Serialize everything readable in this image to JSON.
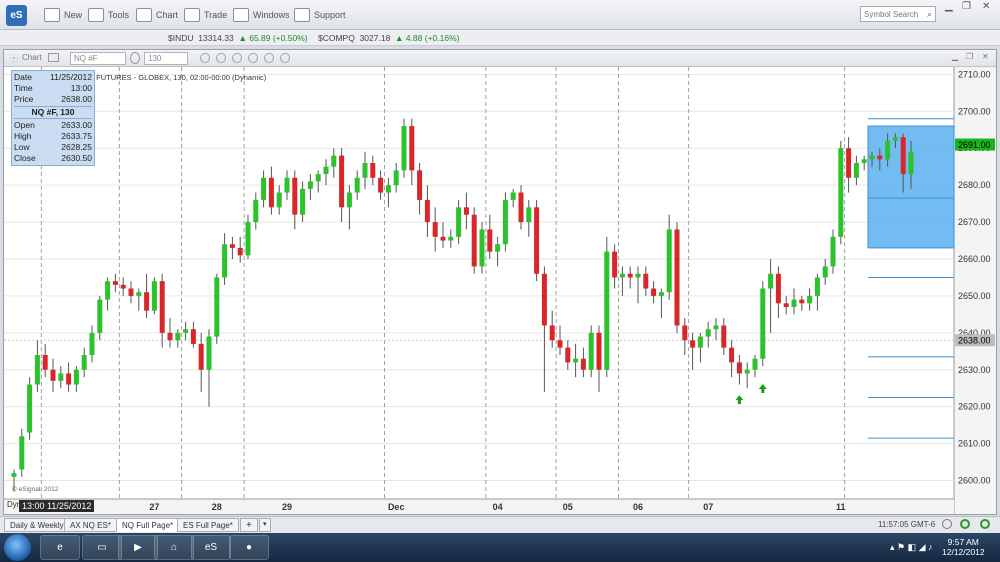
{
  "app": {
    "icon_label": "eS",
    "menu": [
      {
        "label": "New",
        "icon": "new-icon"
      },
      {
        "label": "Tools",
        "icon": "tools-icon"
      },
      {
        "label": "Chart",
        "icon": "chart-icon"
      },
      {
        "label": "Trade",
        "icon": "trade-icon"
      },
      {
        "label": "Windows",
        "icon": "windows-icon"
      },
      {
        "label": "Support",
        "icon": "support-icon"
      }
    ],
    "symbol_search_placeholder": "Symbol Search"
  },
  "ticker": [
    {
      "symbol": "$INDU",
      "price": "13314.33",
      "change": "65.89 (+0.50%)"
    },
    {
      "symbol": "$COMPQ",
      "price": "3027.18",
      "change": "4.88 (+0.16%)"
    }
  ],
  "chart_window": {
    "tab_label": "Chart",
    "symbol_input": "NQ #F",
    "interval_input": "130",
    "title": "I FUTURES - GLOBEX, 130, 02:00-00:00 (Dynamic)",
    "watermark": "© eSignal, 2012",
    "dyn_label": "Dyn",
    "highlight_date": "13:00 11/25/2012"
  },
  "data_window": {
    "date_label": "Date",
    "date_value": "11/25/2012",
    "time_label": "Time",
    "time_value": "13:00",
    "price_label": "Price",
    "price_value": "2638.00",
    "symbol_header": "NQ #F, 130",
    "open_label": "Open",
    "open_value": "2633.00",
    "high_label": "High",
    "high_value": "2633.75",
    "low_label": "Low",
    "low_value": "2628.25",
    "close_label": "Close",
    "close_value": "2630.50"
  },
  "chart_data": {
    "type": "candlestick",
    "y_range": [
      2595,
      2712
    ],
    "y_ticks": [
      2600,
      2610,
      2620,
      2630,
      2640,
      2650,
      2660,
      2670,
      2680,
      2690,
      2700,
      2710
    ],
    "x_labels": [
      "27",
      "28",
      "29",
      "Dec",
      "04",
      "05",
      "06",
      "07",
      "11"
    ],
    "price_labels": [
      {
        "value": "2691.00",
        "price": 2691,
        "color": "#17b517"
      },
      {
        "value": "2638.00",
        "price": 2638,
        "color": "#bdbdbd"
      }
    ],
    "up_color": "#2bc22b",
    "down_color": "#d9262b",
    "candles": [
      [
        2601,
        2603,
        2597,
        2602
      ],
      [
        2603,
        2614,
        2601,
        2612
      ],
      [
        2613,
        2628,
        2611,
        2626
      ],
      [
        2626,
        2638,
        2624,
        2634
      ],
      [
        2634,
        2637,
        2628,
        2630
      ],
      [
        2630,
        2633,
        2624,
        2627
      ],
      [
        2627,
        2631,
        2625,
        2629
      ],
      [
        2629,
        2632,
        2624,
        2626
      ],
      [
        2626,
        2631,
        2624,
        2630
      ],
      [
        2630,
        2636,
        2628,
        2634
      ],
      [
        2634,
        2642,
        2632,
        2640
      ],
      [
        2640,
        2650,
        2638,
        2649
      ],
      [
        2649,
        2655,
        2646,
        2654
      ],
      [
        2654,
        2656,
        2651,
        2653
      ],
      [
        2653,
        2655,
        2650,
        2652
      ],
      [
        2652,
        2654,
        2648,
        2650
      ],
      [
        2650,
        2652,
        2646,
        2651
      ],
      [
        2651,
        2656,
        2644,
        2646
      ],
      [
        2646,
        2655,
        2645,
        2654
      ],
      [
        2654,
        2656,
        2636,
        2640
      ],
      [
        2640,
        2644,
        2636,
        2638
      ],
      [
        2638,
        2641,
        2636,
        2640
      ],
      [
        2640,
        2643,
        2638,
        2641
      ],
      [
        2641,
        2643,
        2636,
        2637
      ],
      [
        2637,
        2640,
        2624,
        2630
      ],
      [
        2630,
        2641,
        2620,
        2639
      ],
      [
        2639,
        2656,
        2637,
        2655
      ],
      [
        2655,
        2667,
        2653,
        2664
      ],
      [
        2664,
        2666,
        2660,
        2663
      ],
      [
        2663,
        2666,
        2659,
        2661
      ],
      [
        2661,
        2672,
        2660,
        2670
      ],
      [
        2670,
        2678,
        2668,
        2676
      ],
      [
        2676,
        2684,
        2674,
        2682
      ],
      [
        2682,
        2685,
        2672,
        2674
      ],
      [
        2674,
        2680,
        2672,
        2678
      ],
      [
        2678,
        2684,
        2676,
        2682
      ],
      [
        2682,
        2684,
        2668,
        2672
      ],
      [
        2672,
        2681,
        2670,
        2679
      ],
      [
        2679,
        2683,
        2676,
        2681
      ],
      [
        2681,
        2684,
        2678,
        2683
      ],
      [
        2683,
        2687,
        2680,
        2685
      ],
      [
        2685,
        2690,
        2682,
        2688
      ],
      [
        2688,
        2690,
        2670,
        2674
      ],
      [
        2674,
        2680,
        2668,
        2678
      ],
      [
        2678,
        2684,
        2676,
        2682
      ],
      [
        2682,
        2689,
        2679,
        2686
      ],
      [
        2686,
        2688,
        2680,
        2682
      ],
      [
        2682,
        2684,
        2676,
        2678
      ],
      [
        2678,
        2682,
        2674,
        2680
      ],
      [
        2680,
        2686,
        2678,
        2684
      ],
      [
        2684,
        2698,
        2682,
        2696
      ],
      [
        2696,
        2698,
        2680,
        2684
      ],
      [
        2684,
        2686,
        2672,
        2676
      ],
      [
        2676,
        2680,
        2666,
        2670
      ],
      [
        2670,
        2674,
        2662,
        2666
      ],
      [
        2666,
        2670,
        2663,
        2665
      ],
      [
        2665,
        2668,
        2663,
        2666
      ],
      [
        2666,
        2676,
        2664,
        2674
      ],
      [
        2674,
        2678,
        2668,
        2672
      ],
      [
        2672,
        2674,
        2656,
        2658
      ],
      [
        2658,
        2670,
        2656,
        2668
      ],
      [
        2668,
        2672,
        2660,
        2662
      ],
      [
        2662,
        2666,
        2658,
        2664
      ],
      [
        2664,
        2678,
        2662,
        2676
      ],
      [
        2676,
        2679,
        2674,
        2678
      ],
      [
        2678,
        2680,
        2668,
        2670
      ],
      [
        2670,
        2676,
        2666,
        2674
      ],
      [
        2674,
        2676,
        2654,
        2656
      ],
      [
        2656,
        2658,
        2624,
        2642
      ],
      [
        2642,
        2646,
        2636,
        2638
      ],
      [
        2638,
        2642,
        2634,
        2636
      ],
      [
        2636,
        2638,
        2630,
        2632
      ],
      [
        2632,
        2637,
        2628,
        2633
      ],
      [
        2633,
        2636,
        2628,
        2630
      ],
      [
        2630,
        2642,
        2628,
        2640
      ],
      [
        2640,
        2642,
        2624,
        2630
      ],
      [
        2630,
        2666,
        2628,
        2662
      ],
      [
        2662,
        2664,
        2652,
        2655
      ],
      [
        2655,
        2658,
        2650,
        2656
      ],
      [
        2656,
        2658,
        2652,
        2655
      ],
      [
        2655,
        2658,
        2648,
        2656
      ],
      [
        2656,
        2658,
        2650,
        2652
      ],
      [
        2652,
        2654,
        2648,
        2650
      ],
      [
        2650,
        2652,
        2644,
        2651
      ],
      [
        2651,
        2672,
        2649,
        2668
      ],
      [
        2668,
        2670,
        2640,
        2642
      ],
      [
        2642,
        2644,
        2634,
        2638
      ],
      [
        2638,
        2640,
        2630,
        2636
      ],
      [
        2636,
        2640,
        2632,
        2639
      ],
      [
        2639,
        2643,
        2636,
        2641
      ],
      [
        2641,
        2644,
        2638,
        2642
      ],
      [
        2642,
        2644,
        2634,
        2636
      ],
      [
        2636,
        2638,
        2628,
        2632
      ],
      [
        2632,
        2634,
        2626,
        2629
      ],
      [
        2629,
        2632,
        2625,
        2630
      ],
      [
        2630,
        2634,
        2628,
        2633
      ],
      [
        2633,
        2654,
        2631,
        2652
      ],
      [
        2652,
        2660,
        2640,
        2656
      ],
      [
        2656,
        2658,
        2644,
        2648
      ],
      [
        2648,
        2650,
        2645,
        2647
      ],
      [
        2647,
        2652,
        2645,
        2649
      ],
      [
        2649,
        2650,
        2646,
        2648
      ],
      [
        2648,
        2652,
        2646,
        2650
      ],
      [
        2650,
        2656,
        2646,
        2655
      ],
      [
        2655,
        2660,
        2653,
        2658
      ],
      [
        2658,
        2668,
        2656,
        2666
      ],
      [
        2666,
        2692,
        2664,
        2690
      ],
      [
        2690,
        2693,
        2678,
        2682
      ],
      [
        2682,
        2688,
        2680,
        2686
      ],
      [
        2686,
        2688,
        2684,
        2687
      ],
      [
        2687,
        2689,
        2685,
        2688
      ],
      [
        2688,
        2690,
        2684,
        2687
      ],
      [
        2687,
        2694,
        2685,
        2692
      ],
      [
        2692,
        2694,
        2690,
        2693
      ],
      [
        2693,
        2694,
        2678,
        2683
      ],
      [
        2683,
        2692,
        2679,
        2689
      ]
    ],
    "rectangle": {
      "price_top": 2696,
      "price_bottom": 2663,
      "from_bar": 110,
      "to_bar": 120
    },
    "fib_levels": [
      2698,
      2676.5,
      2655,
      2633.5,
      2622.5,
      2611.5
    ],
    "arrows": [
      {
        "bar": 93,
        "price": 2624.5
      },
      {
        "bar": 96,
        "price": 2627.5
      }
    ]
  },
  "tabs": [
    {
      "label": "Daily & Weekly"
    },
    {
      "label": "AX NQ ES*"
    },
    {
      "label": "NQ Full Page*"
    },
    {
      "label": "ES Full Page*"
    }
  ],
  "status": {
    "time": "11:57:05 GMT-6"
  },
  "taskbar": {
    "apps": [
      "ie-icon",
      "folder-icon",
      "media-icon",
      "network-icon",
      "esignal-icon",
      "recorder-icon"
    ],
    "esignal_label": "eS",
    "clock_time": "9:57 AM",
    "clock_date": "12/12/2012"
  }
}
